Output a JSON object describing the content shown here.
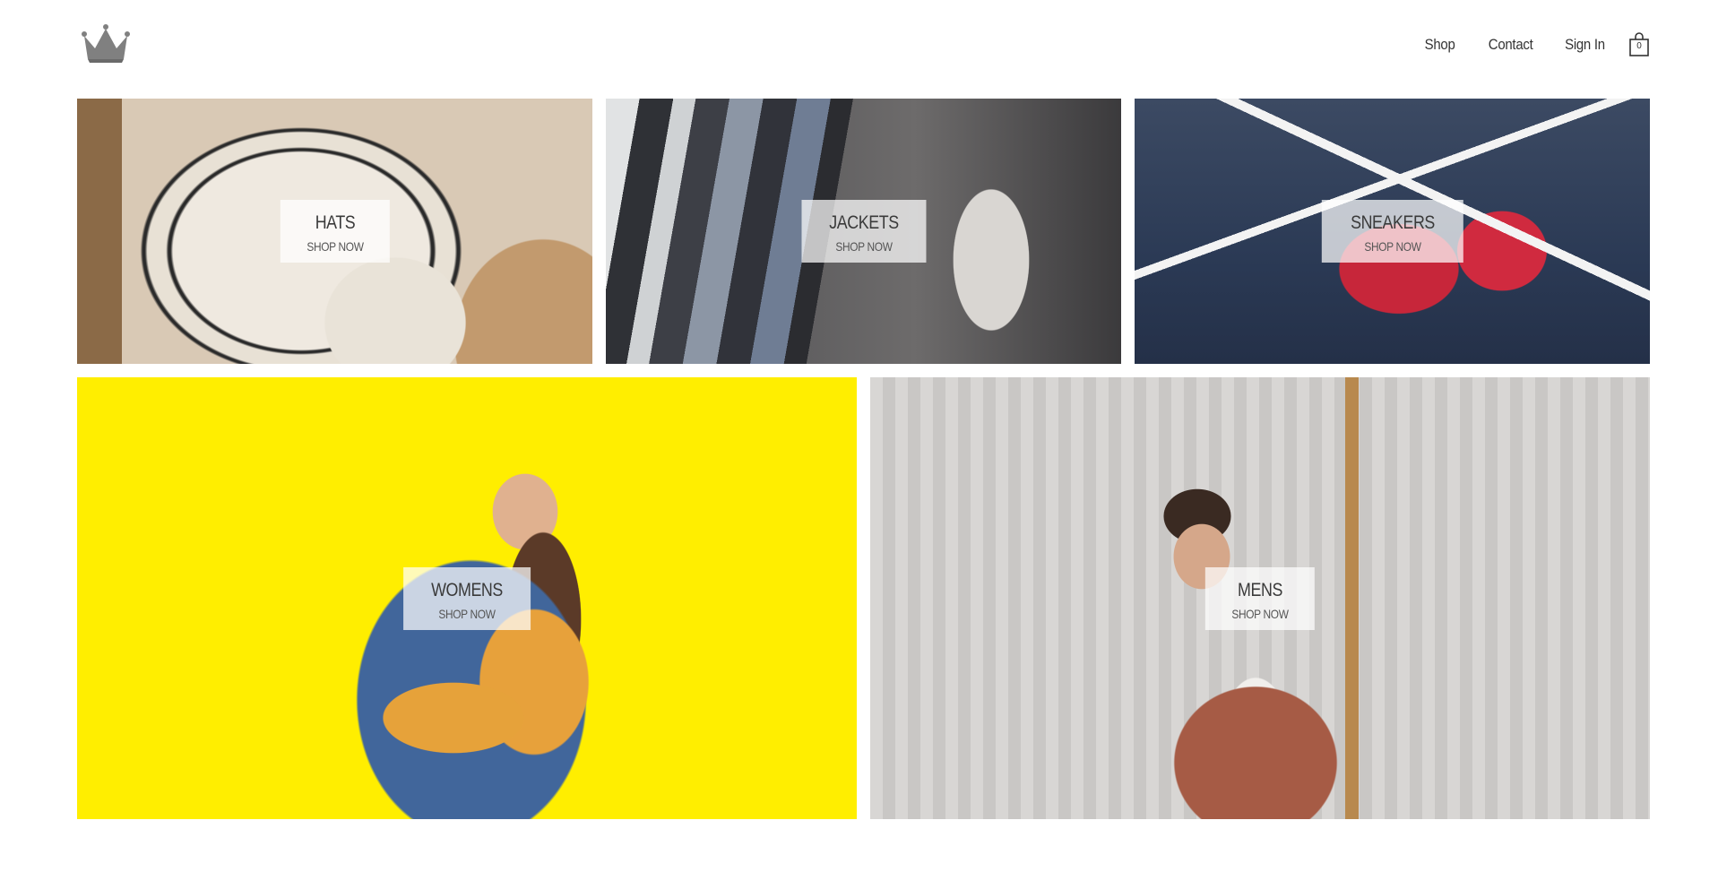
{
  "header": {
    "logo_icon": "crown-icon",
    "nav": {
      "shop": "Shop",
      "contact": "Contact",
      "sign_in": "Sign In"
    },
    "cart": {
      "icon": "shopping-bag-icon",
      "count": "0"
    }
  },
  "directory": [
    {
      "title": "HATS",
      "cta": "SHOP NOW"
    },
    {
      "title": "JACKETS",
      "cta": "SHOP NOW"
    },
    {
      "title": "SNEAKERS",
      "cta": "SHOP NOW"
    },
    {
      "title": "WOMENS",
      "cta": "SHOP NOW"
    },
    {
      "title": "MENS",
      "cta": "SHOP NOW"
    }
  ],
  "colors": {
    "text": "#333333",
    "overlay": "#ffffff",
    "womens_bg": "#ffee00"
  }
}
